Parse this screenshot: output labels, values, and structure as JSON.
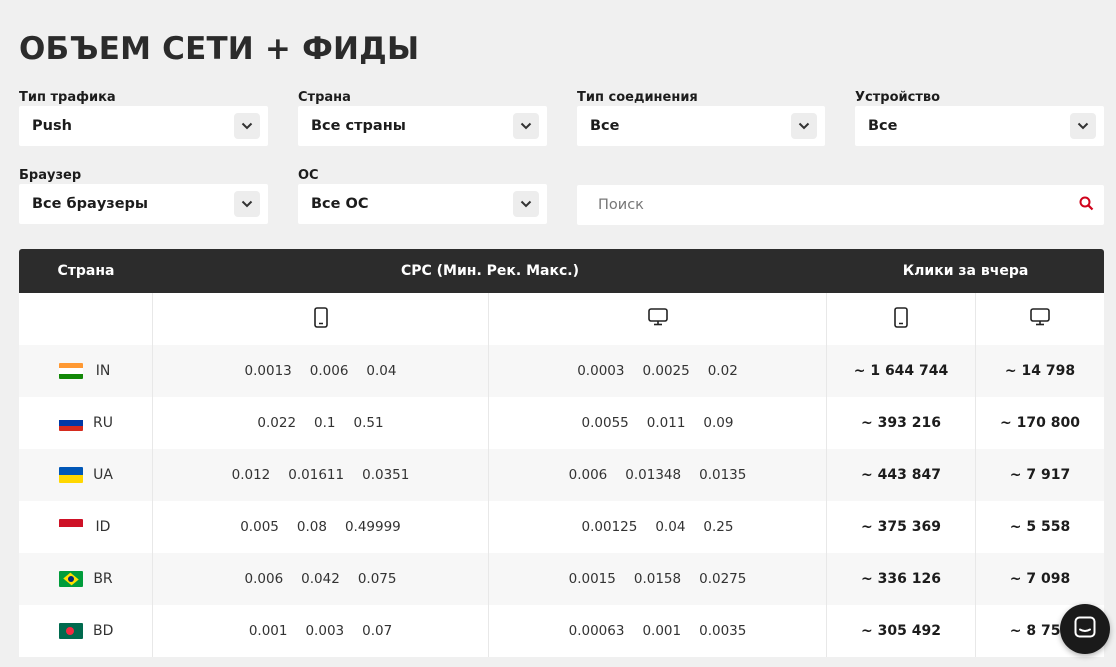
{
  "title": "ОБЪЕМ СЕТИ + ФИДЫ",
  "filters": {
    "traffic_type": {
      "label": "Тип трафика",
      "value": "Push"
    },
    "country": {
      "label": "Страна",
      "value": "Все страны"
    },
    "connection": {
      "label": "Тип соединения",
      "value": "Все"
    },
    "device": {
      "label": "Устройство",
      "value": "Все"
    },
    "browser": {
      "label": "Браузер",
      "value": "Все браузеры"
    },
    "os": {
      "label": "ОС",
      "value": "Все ОС"
    }
  },
  "search": {
    "placeholder": "Поиск",
    "icon": "search-icon"
  },
  "table": {
    "headers": {
      "country": "Страна",
      "cpc": "CPC (Мин. Рек. Макс.)",
      "clicks": "Клики за вчера"
    },
    "device_icons": [
      "mobile-icon",
      "desktop-icon",
      "mobile-icon",
      "desktop-icon"
    ],
    "rows": [
      {
        "code": "IN",
        "flag": [
          "#ff9933",
          "#ffffff",
          "#138808"
        ],
        "cpc_mobile": [
          "0.0013",
          "0.006",
          "0.04"
        ],
        "cpc_desktop": [
          "0.0003",
          "0.0025",
          "0.02"
        ],
        "clicks_mobile": "~ 1 644 744",
        "clicks_desktop": "~ 14 798"
      },
      {
        "code": "RU",
        "flag": [
          "#ffffff",
          "#0039a6",
          "#d52b1e"
        ],
        "cpc_mobile": [
          "0.022",
          "0.1",
          "0.51"
        ],
        "cpc_desktop": [
          "0.0055",
          "0.011",
          "0.09"
        ],
        "clicks_mobile": "~ 393 216",
        "clicks_desktop": "~ 170 800"
      },
      {
        "code": "UA",
        "flag": [
          "#0057b7",
          "#ffd700"
        ],
        "cpc_mobile": [
          "0.012",
          "0.01611",
          "0.0351"
        ],
        "cpc_desktop": [
          "0.006",
          "0.01348",
          "0.0135"
        ],
        "clicks_mobile": "~ 443 847",
        "clicks_desktop": "~ 7 917"
      },
      {
        "code": "ID",
        "flag": [
          "#ce1126",
          "#ffffff"
        ],
        "cpc_mobile": [
          "0.005",
          "0.08",
          "0.49999"
        ],
        "cpc_desktop": [
          "0.00125",
          "0.04",
          "0.25"
        ],
        "clicks_mobile": "~ 375 369",
        "clicks_desktop": "~ 5 558"
      },
      {
        "code": "BR",
        "flag": [
          "#009c3b"
        ],
        "cpc_mobile": [
          "0.006",
          "0.042",
          "0.075"
        ],
        "cpc_desktop": [
          "0.0015",
          "0.0158",
          "0.0275"
        ],
        "clicks_mobile": "~ 336 126",
        "clicks_desktop": "~ 7 098"
      },
      {
        "code": "BD",
        "flag": [
          "#006a4e"
        ],
        "cpc_mobile": [
          "0.001",
          "0.003",
          "0.07"
        ],
        "cpc_desktop": [
          "0.00063",
          "0.001",
          "0.0035"
        ],
        "clicks_mobile": "~ 305 492",
        "clicks_desktop": "~ 8 757"
      }
    ]
  },
  "chat": {
    "icon": "chat-icon"
  }
}
